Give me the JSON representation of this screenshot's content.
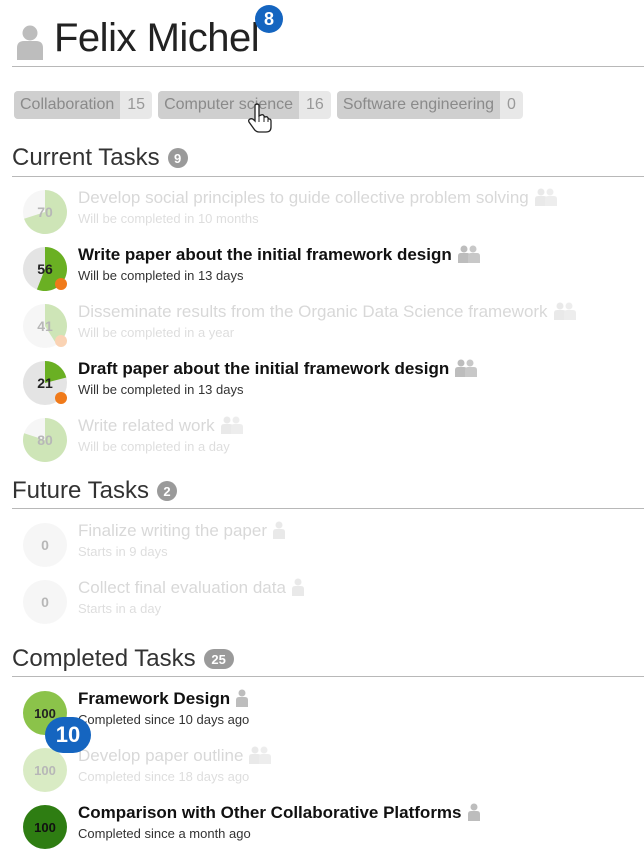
{
  "header": {
    "user_name": "Felix Michel",
    "callout_top": "8",
    "callout_bottom": "10"
  },
  "tags": [
    {
      "label": "Collaboration",
      "count": "15"
    },
    {
      "label": "Computer science",
      "count": "16"
    },
    {
      "label": "Software engineering",
      "count": "0"
    }
  ],
  "sections": {
    "current": {
      "title": "Current Tasks",
      "count": "9"
    },
    "future": {
      "title": "Future Tasks",
      "count": "2"
    },
    "completed": {
      "title": "Completed Tasks",
      "count": "25"
    }
  },
  "current_tasks": [
    {
      "progress": "70",
      "title": "Develop social principles to guide collective problem solving",
      "status": "Will be completed in 10 months",
      "active": false,
      "owner_icon": "group-icon"
    },
    {
      "progress": "56",
      "title": "Write paper about the initial framework design",
      "status": "Will be completed in 13 days",
      "active": true,
      "owner_icon": "group-icon",
      "alert": true
    },
    {
      "progress": "41",
      "title": "Disseminate results from the Organic Data Science framework",
      "status": "Will be completed in a year",
      "active": false,
      "owner_icon": "group-icon",
      "alert": true
    },
    {
      "progress": "21",
      "title": "Draft paper about the initial framework design",
      "status": "Will be completed in 13 days",
      "active": true,
      "owner_icon": "group-icon",
      "alert": true
    },
    {
      "progress": "80",
      "title": "Write related work",
      "status": "Will be completed in a day",
      "active": false,
      "owner_icon": "group-icon"
    }
  ],
  "future_tasks": [
    {
      "progress": "0",
      "title": "Finalize writing the paper",
      "status": "Starts in 9 days",
      "active": false,
      "owner_icon": "person-icon"
    },
    {
      "progress": "0",
      "title": "Collect final evaluation data",
      "status": "Starts in a day",
      "active": false,
      "owner_icon": "person-icon"
    }
  ],
  "completed_tasks": [
    {
      "progress": "100",
      "title": "Framework Design",
      "status": "Completed since 10 days ago",
      "active": true,
      "owner_icon": "person-icon",
      "color": "#8bc34a"
    },
    {
      "progress": "100",
      "title": "Develop paper outline",
      "status": "Completed since 18 days ago",
      "active": false,
      "owner_icon": "group-icon",
      "color": "#8bc34a"
    },
    {
      "progress": "100",
      "title": "Comparison with Other Collaborative Platforms",
      "status": "Completed since a month ago",
      "active": true,
      "owner_icon": "person-icon",
      "color": "#2e7d12"
    }
  ],
  "colors": {
    "progress_green": "#6ab023",
    "progress_track": "#e4e4e4",
    "alert_orange": "#f07a1a",
    "callout_blue": "#1565c0"
  }
}
